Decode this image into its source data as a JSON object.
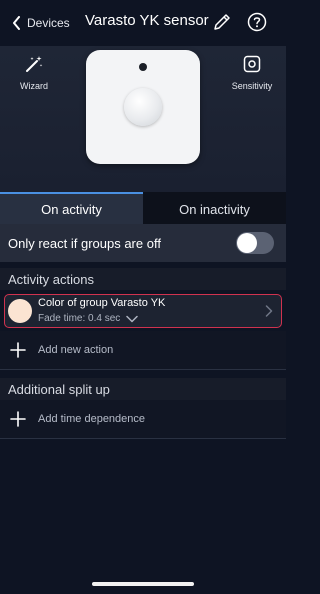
{
  "header": {
    "back_label": "Devices",
    "title": "Varasto YK sensor"
  },
  "hero": {
    "wizard_label": "Wizard",
    "sensitivity_label": "Sensitivity"
  },
  "tabs": [
    {
      "label": "On activity",
      "active": true
    },
    {
      "label": "On inactivity",
      "active": false
    }
  ],
  "groups_off": {
    "label": "Only react if groups are off",
    "enabled": false
  },
  "activity_actions": {
    "header": "Activity actions",
    "items": [
      {
        "title": "Color of group Varasto YK",
        "subtitle": "Fade time: 0.4 sec",
        "color": "#fbe4d2"
      }
    ],
    "add_label": "Add new action"
  },
  "split_up": {
    "header": "Additional split up",
    "add_label": "Add time dependence"
  },
  "colors": {
    "background": "#0e1423",
    "accent": "#4a90e2",
    "highlight_border": "#d0324f"
  }
}
